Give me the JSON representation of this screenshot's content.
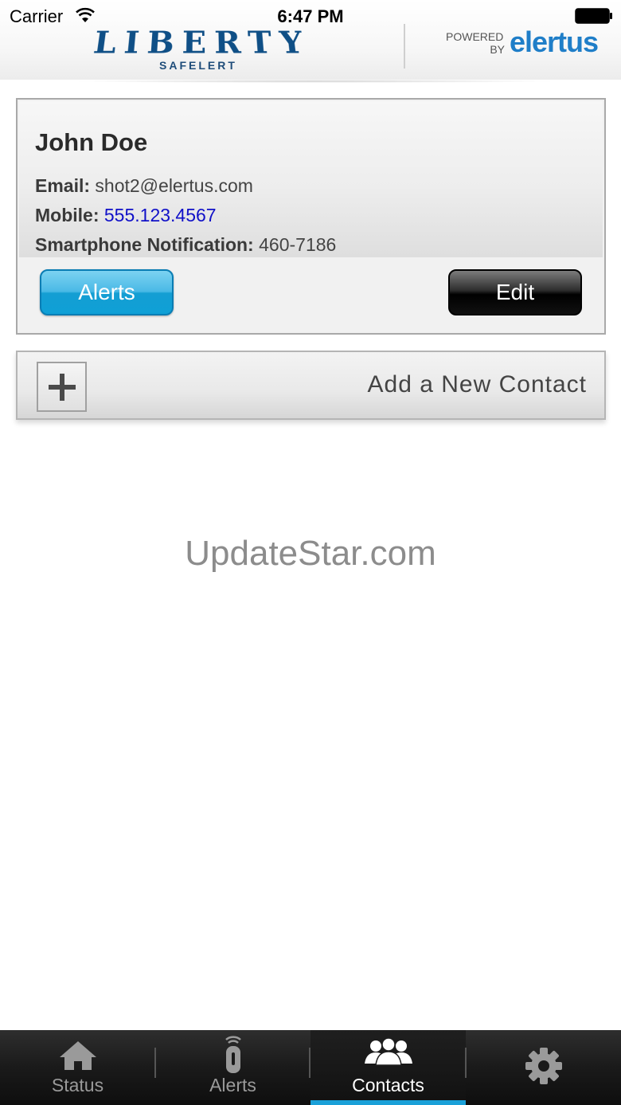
{
  "status_bar": {
    "carrier": "Carrier",
    "time": "6:47 PM"
  },
  "header": {
    "brand": "LIBERTY",
    "brand_sub": "SAFELERT",
    "powered_line1": "POWERED",
    "powered_line2": "BY",
    "partner": "elertus",
    "brand_color": "#0f4f86",
    "partner_color": "#1f7ec8"
  },
  "contact": {
    "name": "John Doe",
    "email_label": "Email:",
    "email": "shot2@elertus.com",
    "mobile_label": "Mobile:",
    "mobile": "555.123.4567",
    "notification_label": "Smartphone Notification:",
    "notification": "460-7186",
    "alerts_button": "Alerts",
    "edit_button": "Edit"
  },
  "add_contact": {
    "label": "Add a New Contact",
    "icon": "plus-icon"
  },
  "watermark": "UpdateStar.com",
  "tabbar": {
    "active_tab": "Contacts",
    "accent_color": "#1aa0d8",
    "tabs": [
      {
        "label": "Status",
        "icon": "home-icon"
      },
      {
        "label": "Alerts",
        "icon": "sensor-icon"
      },
      {
        "label": "Contacts",
        "icon": "people-icon"
      },
      {
        "label": "",
        "icon": "gear-icon"
      }
    ]
  }
}
